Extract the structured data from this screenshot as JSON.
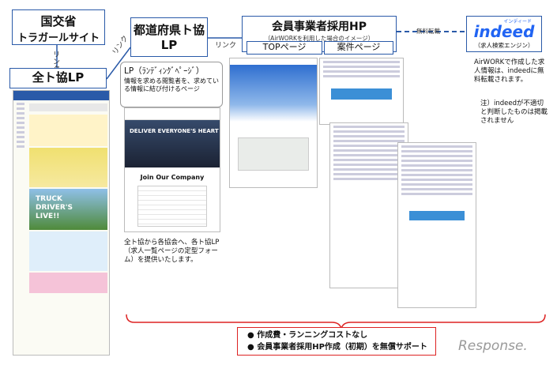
{
  "nodes": {
    "mlit": {
      "line1": "国交省",
      "line2": "トラガールサイト"
    },
    "zentokyo": {
      "label": "全ト協LP"
    },
    "prefecture": {
      "line1": "都道府県ト協",
      "line2": "LP"
    },
    "member_hp": {
      "title": "会員事業者採用HP",
      "subtitle": "（AirWORKを利用した場合のイメージ）",
      "top_tab": "TOPページ",
      "job_tab": "案件ページ"
    },
    "indeed": {
      "logo_kana": "インディード",
      "logo": "indeed",
      "caption": "（求人検索エンジン）"
    }
  },
  "edge_labels": {
    "link1": "リンク",
    "link2": "リンク",
    "link3": "リンク",
    "free": "無料転載"
  },
  "lp_note": {
    "title": "LP（ﾗﾝﾃﾞｨﾝｸﾞﾍﾟｰｼﾞ）",
    "body": "情報を求める閲覧者を、求めている情報に結び付けるページ"
  },
  "screens": {
    "left_site_banner": "TRUCK DRIVER'S LIVE!!",
    "lp_hero": "DELIVER EVERYONE'S HEART",
    "lp_section": "Join Our Company"
  },
  "notes": {
    "form": "全ト協から各協会へ、各ト協LP（求人一覧ページの定型フォーム）を提供いたします。",
    "airwork": "AirWORKで作成した求人情報は、indeedに無料転載されます。",
    "caution": "注）indeedが不適切と判断したものは掲載されません"
  },
  "summary": [
    "作成費・ランニングコストなし",
    "会員事業者採用HP作成（初期）を無償サポート"
  ],
  "watermark": "Response.",
  "colors": {
    "accent": "#2a5aa8",
    "bracket": "#d22",
    "indeed": "#2164f3"
  }
}
